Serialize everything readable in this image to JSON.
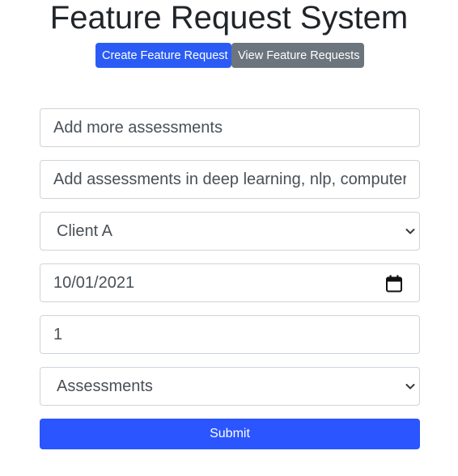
{
  "page": {
    "title": "Feature Request System"
  },
  "nav": {
    "create_label": "Create Feature Request",
    "view_label": "View Feature Requests"
  },
  "form": {
    "title_value": "Add more assessments",
    "description_value": "Add assessments in deep learning, nlp, computer vision",
    "client_selected": "Client A",
    "target_date_value": "10/01/2021",
    "priority_value": "1",
    "product_area_selected": "Assessments",
    "submit_label": "Submit"
  },
  "icons": {
    "client_chevron": "chevron-down-icon",
    "date_calendar": "calendar-icon",
    "area_chevron": "chevron-down-icon"
  },
  "colors": {
    "primary": "#2a5cf5",
    "secondary": "#6c757d",
    "submit": "#2a55ff"
  }
}
